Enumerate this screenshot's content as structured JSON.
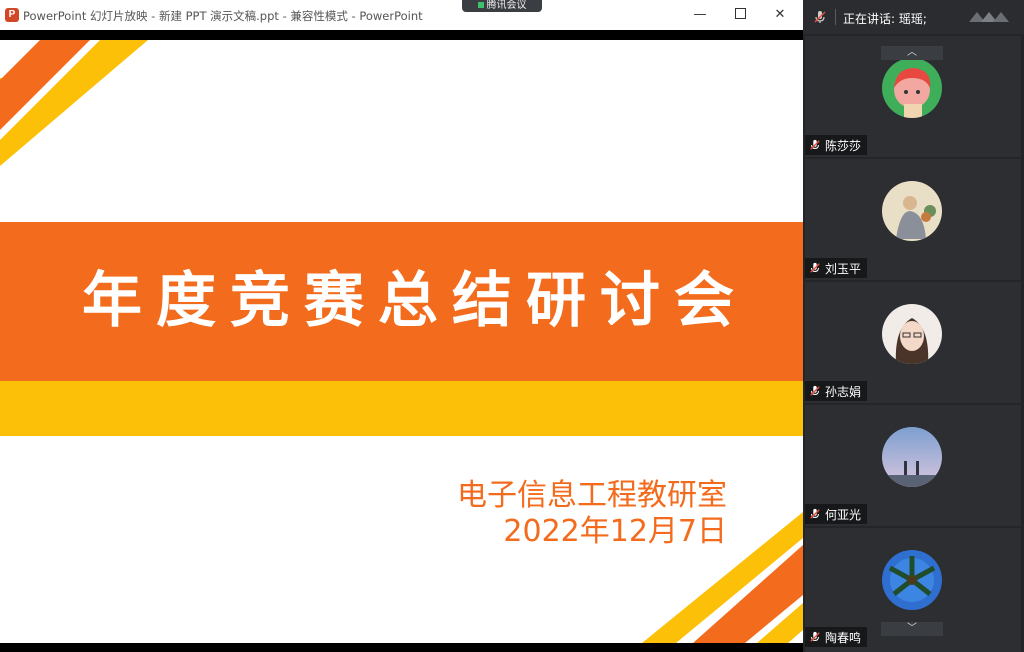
{
  "window": {
    "app_icon": "P",
    "title": "PowerPoint 幻灯片放映 - 新建 PPT 演示文稿.ppt - 兼容性模式 - PowerPoint",
    "minimize": "—",
    "close": "✕"
  },
  "tencent_badge": "腾讯会议",
  "slide": {
    "title": "年度竞赛总结研讨会",
    "department": "电子信息工程教研室",
    "date": "2022年12月7日"
  },
  "meeting": {
    "speaking_label": "正在讲话: 瑶瑶;",
    "scroll_up": "︿",
    "scroll_down": "﹀",
    "participants": [
      {
        "name": "陈莎莎",
        "avatar": "cartoon-girl-avatar"
      },
      {
        "name": "刘玉平",
        "avatar": "monk-painting-avatar"
      },
      {
        "name": "孙志娟",
        "avatar": "woman-photo-avatar"
      },
      {
        "name": "何亚光",
        "avatar": "anime-sky-avatar"
      },
      {
        "name": "陶春鸣",
        "avatar": "palm-tree-avatar"
      }
    ]
  },
  "colors": {
    "orange": "#f36b1c",
    "yellow": "#fdc008",
    "panel_bg": "#232528"
  }
}
